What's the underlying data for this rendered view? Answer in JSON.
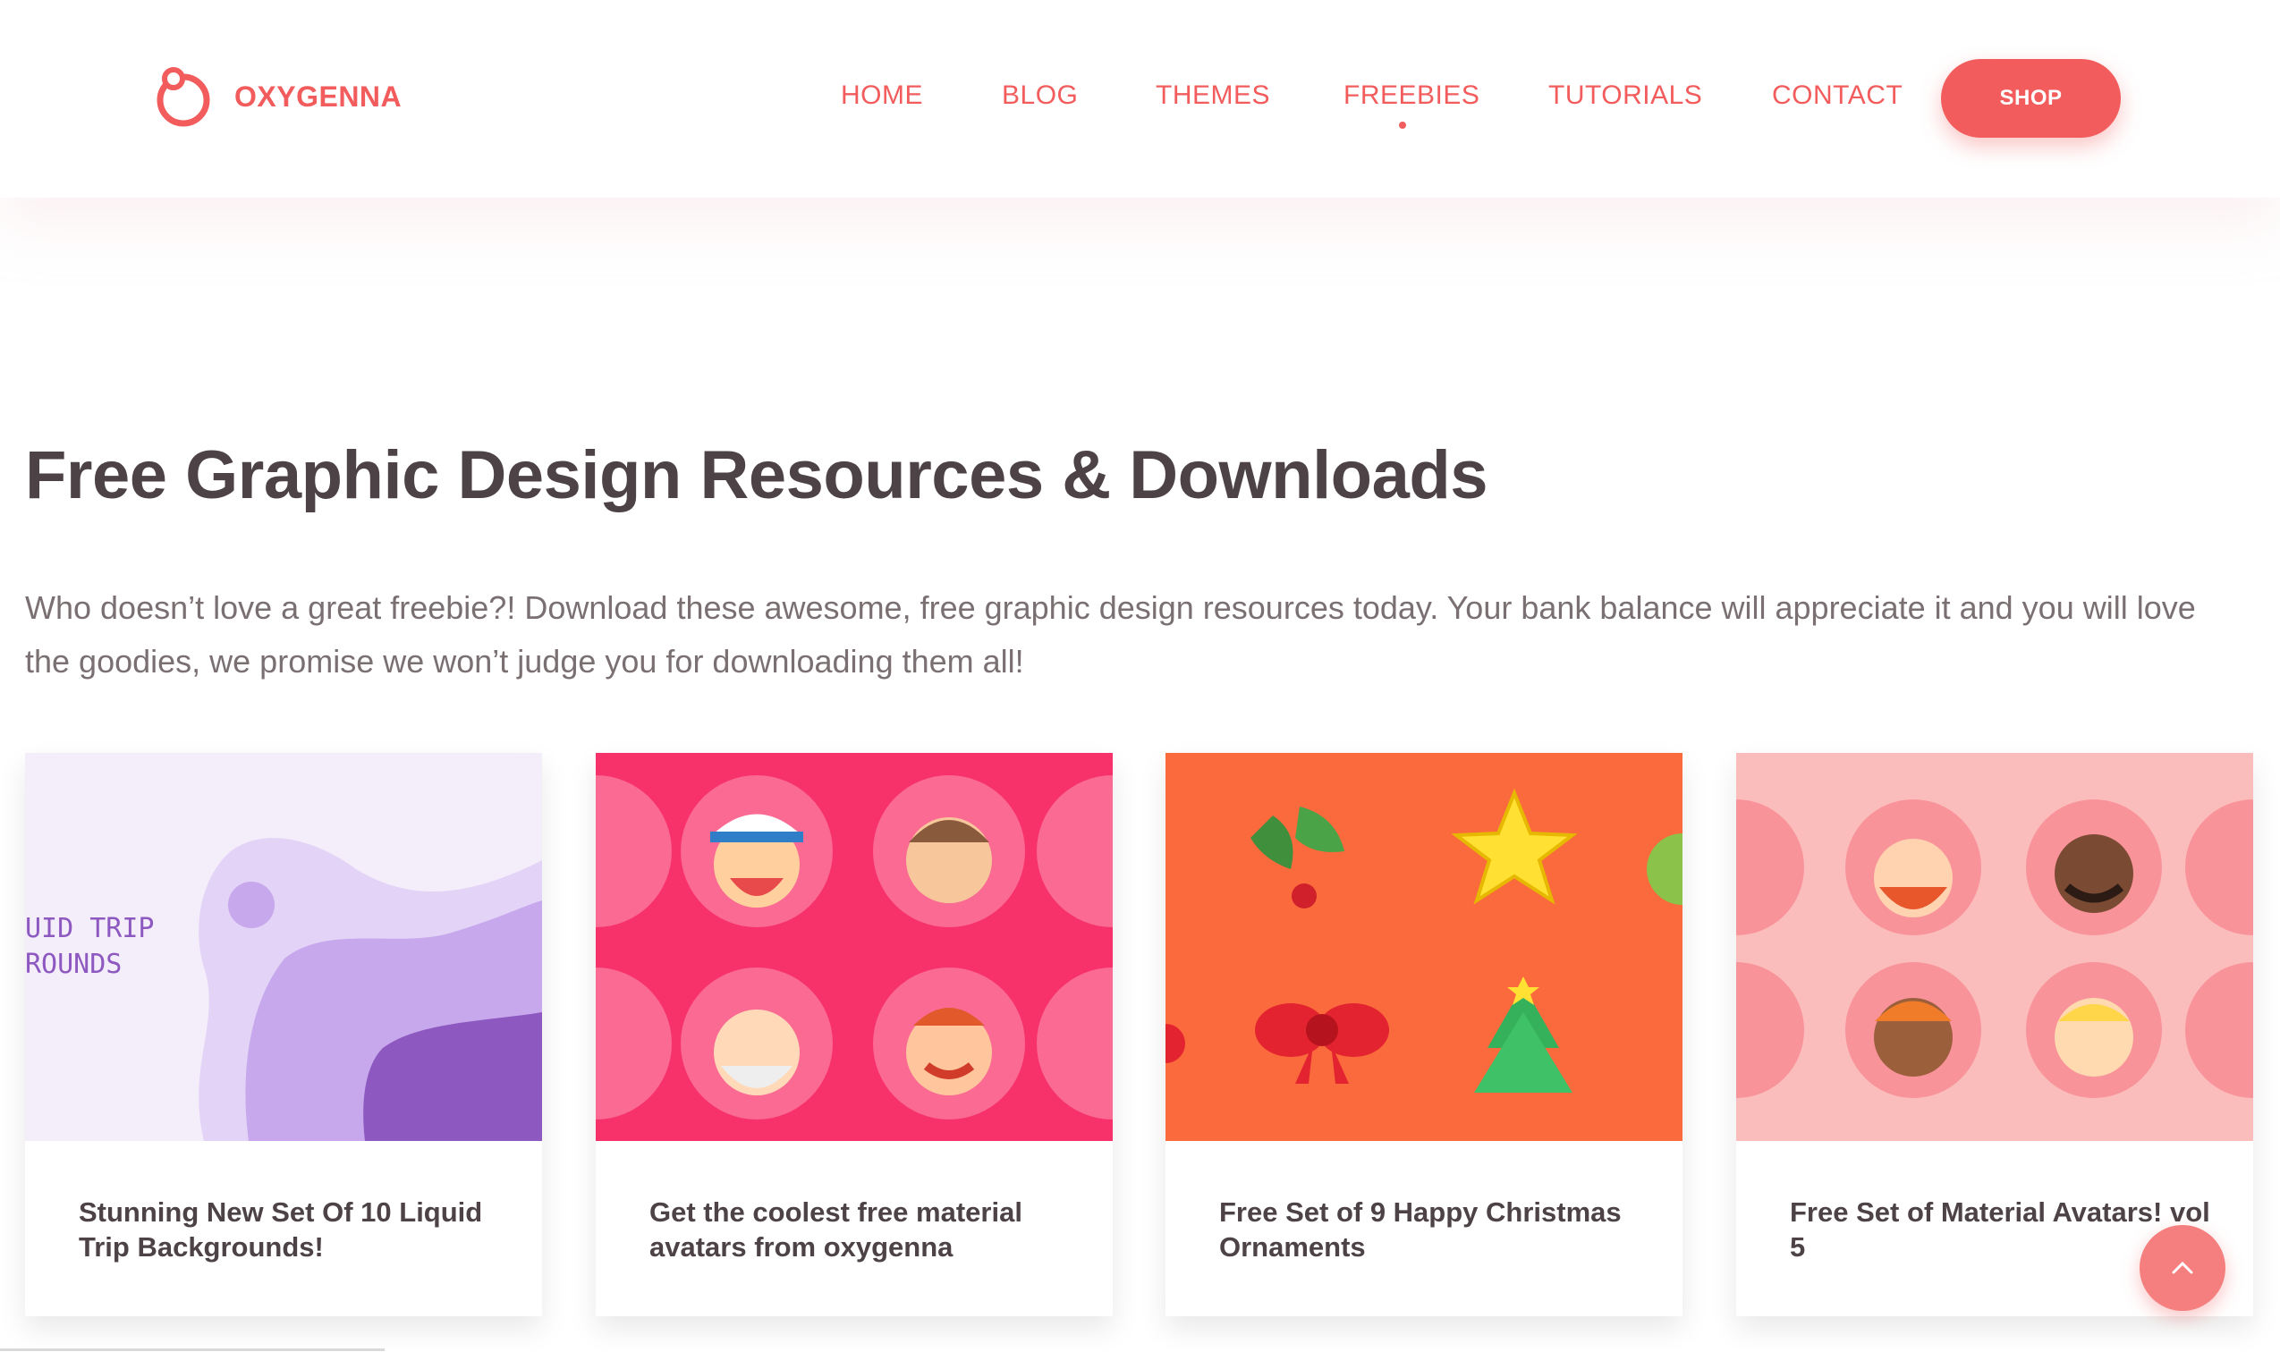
{
  "brand": {
    "name": "OXYGENNA",
    "logo_icon": "oxygenna-logo-icon",
    "color": "#f25c5c"
  },
  "nav": {
    "items": [
      {
        "label": "HOME"
      },
      {
        "label": "BLOG"
      },
      {
        "label": "THEMES"
      },
      {
        "label": "FREEBIES",
        "active": true
      },
      {
        "label": "TUTORIALS"
      },
      {
        "label": "CONTACT"
      }
    ],
    "shop_label": "SHOP"
  },
  "hero": {
    "title": "Free Graphic Design Resources & Downloads",
    "intro": "Who doesn’t love a great freebie?! Download these awesome, free graphic design resources today. Your bank balance will appreciate it and you will love the goodies, we promise we won’t judge you for downloading them all!"
  },
  "cards": [
    {
      "title": "Stunning New Set Of 10 Liquid Trip Backgrounds!",
      "image_text_1": "UID TRIP",
      "image_text_2": "ROUNDS",
      "bg": "#f4eefb"
    },
    {
      "title": "Get the coolest free material avatars from oxygenna",
      "bg": "#f7326a"
    },
    {
      "title": "Free Set of 9 Happy Christmas Ornaments",
      "bg": "#fb6a3c"
    },
    {
      "title": "Free Set of Material Avatars! vol 5",
      "bg": "#fbbcbc"
    }
  ],
  "scroll_top_icon": "chevron-up-icon"
}
